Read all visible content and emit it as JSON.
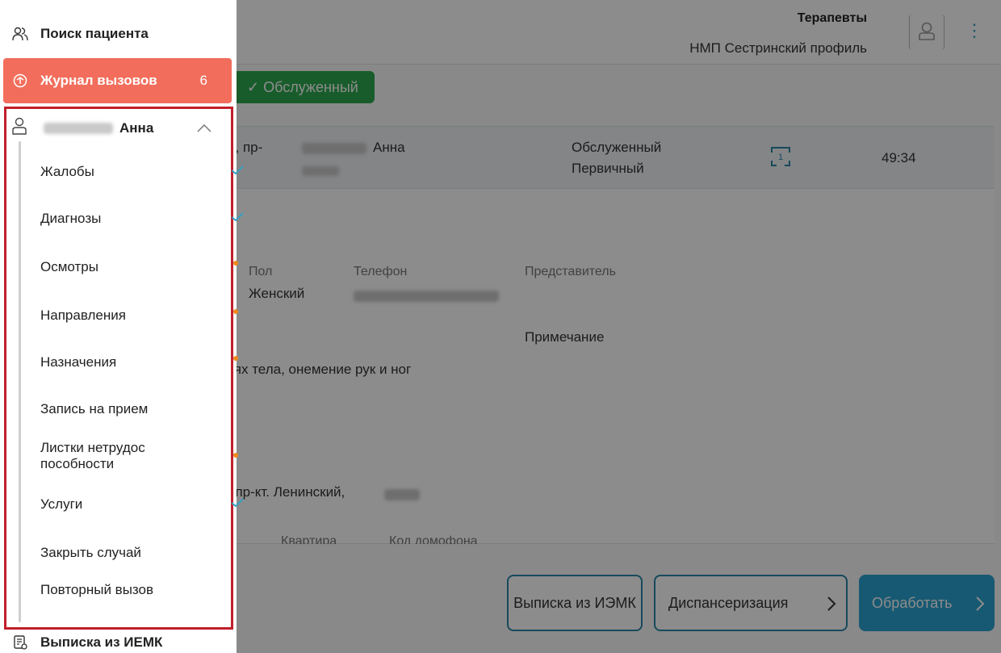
{
  "header": {
    "department": "Терапевты",
    "profile": "НМП Сестринский профиль"
  },
  "call": {
    "status_button": "✓ Обслуженный",
    "address_fragment": "и, пр-",
    "patient_name": "Анна",
    "status": "Обслуженный",
    "type": "Первичный",
    "time": "49:34"
  },
  "details": {
    "sex_label": "Пол",
    "sex_value": "Женский",
    "phone_label": "Телефон",
    "representative_label": "Представитель",
    "note_label": "Примечание",
    "complaint_fragment": "тях тела, онемение рук и ног",
    "address_fragment": ", пр-кт. Ленинский,",
    "apartment_label": "Квартира",
    "intercom_label": "Код домофона"
  },
  "footer": {
    "iemk_button": "Выписка из ИЭМК",
    "dispanserization_button": "Диспансеризация",
    "process_button": "Обработать"
  },
  "sidebar": {
    "search_patient": "Поиск пациента",
    "journal": "Журнал вызовов",
    "journal_count": "6",
    "case_name": "Анна",
    "items": [
      {
        "label": "Жалобы",
        "mark": "check"
      },
      {
        "label": "Диагнозы",
        "mark": "check"
      },
      {
        "label": "Осмотры",
        "mark": "dot"
      },
      {
        "label": "Направления",
        "mark": "dot"
      },
      {
        "label": "Назначения",
        "mark": "dot"
      },
      {
        "label": "Запись на прием",
        "mark": "none"
      },
      {
        "label": "Листки нетрудос пособности",
        "mark": "dot"
      },
      {
        "label": "Услуги",
        "mark": "check"
      },
      {
        "label": "Закрыть случай",
        "mark": "none"
      },
      {
        "label": "Повторный вызов",
        "mark": "none"
      }
    ],
    "iemk_link": "Выписка из ИЕМК"
  },
  "colors": {
    "journal_bg": "#f26d5b",
    "highlight_border": "#c0202b",
    "check": "#2ea0c7",
    "dot": "#f08a1c",
    "status_green": "#2fa84f",
    "primary_blue": "#2ba3cf"
  }
}
